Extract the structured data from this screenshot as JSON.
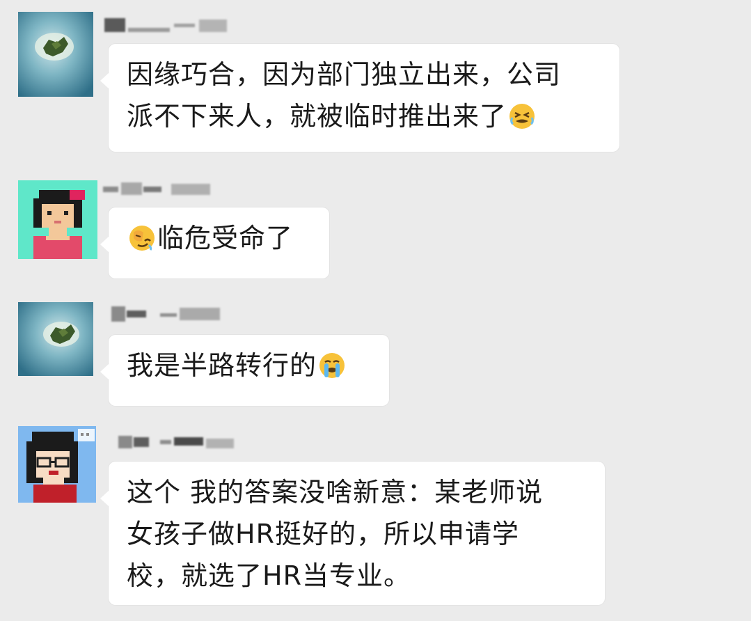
{
  "messages": [
    {
      "sender": "island-avatar",
      "lines": [
        "因缘巧合，因为部门独立出来，公司",
        "派不下来人，就被临时推出来了"
      ],
      "trailing_emoji": "grimace-emoji"
    },
    {
      "sender": "girl-avatar",
      "leading_emoji": "facepalm-emoji",
      "lines": [
        "临危受命了"
      ]
    },
    {
      "sender": "island-avatar",
      "lines": [
        "我是半路转行的"
      ],
      "trailing_emoji": "crying-emoji"
    },
    {
      "sender": "glasses-girl-avatar",
      "lines": [
        "这个 我的答案没啥新意：某老师说",
        "女孩子做HR挺好的，所以申请学",
        "校，就选了HR当专业。"
      ]
    }
  ],
  "colors": {
    "chat_background": "#ebebeb",
    "bubble": "#ffffff",
    "text": "#1a1a1a",
    "name_blur": "#6a6a6a"
  }
}
